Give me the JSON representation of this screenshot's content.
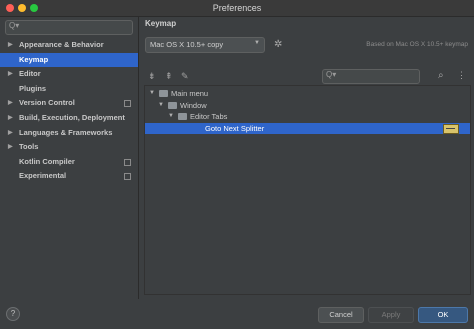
{
  "window": {
    "title": "Preferences"
  },
  "sidebar": {
    "search_placeholder": "",
    "search_glyph": "Q▾",
    "items": [
      {
        "label": "Appearance & Behavior",
        "expandable": true,
        "project_level": false,
        "selected": false
      },
      {
        "label": "Keymap",
        "expandable": false,
        "project_level": false,
        "selected": true
      },
      {
        "label": "Editor",
        "expandable": true,
        "project_level": false,
        "selected": false
      },
      {
        "label": "Plugins",
        "expandable": false,
        "project_level": false,
        "selected": false
      },
      {
        "label": "Version Control",
        "expandable": true,
        "project_level": true,
        "selected": false
      },
      {
        "label": "Build, Execution, Deployment",
        "expandable": true,
        "project_level": false,
        "selected": false
      },
      {
        "label": "Languages & Frameworks",
        "expandable": true,
        "project_level": false,
        "selected": false
      },
      {
        "label": "Tools",
        "expandable": true,
        "project_level": false,
        "selected": false
      },
      {
        "label": "Kotlin Compiler",
        "expandable": false,
        "project_level": true,
        "selected": false
      },
      {
        "label": "Experimental",
        "expandable": false,
        "project_level": true,
        "selected": false
      }
    ]
  },
  "keymap": {
    "heading": "Keymap",
    "scheme_value": "Mac OS X 10.5+ copy",
    "based_on": "Based on Mac OS X 10.5+ keymap",
    "search_glyph": "Q▾",
    "toolbar_icons": [
      "expand-all-icon",
      "collapse-all-icon",
      "edit-icon"
    ],
    "tree": [
      {
        "label": "Main menu",
        "level": 0,
        "arrow": "▼",
        "folder": true,
        "selected": false
      },
      {
        "label": "Window",
        "level": 1,
        "arrow": "▼",
        "folder": true,
        "selected": false
      },
      {
        "label": "Editor Tabs",
        "level": 2,
        "arrow": "▼",
        "folder": true,
        "selected": false
      },
      {
        "label": "Goto Next Splitter",
        "level": 3,
        "arrow": "",
        "folder": false,
        "selected": true
      }
    ]
  },
  "footer": {
    "help": "?",
    "cancel": "Cancel",
    "apply": "Apply",
    "ok": "OK"
  },
  "colors": {
    "selection": "#2f65ca",
    "background": "#3c3f41",
    "ok_button": "#365880"
  }
}
